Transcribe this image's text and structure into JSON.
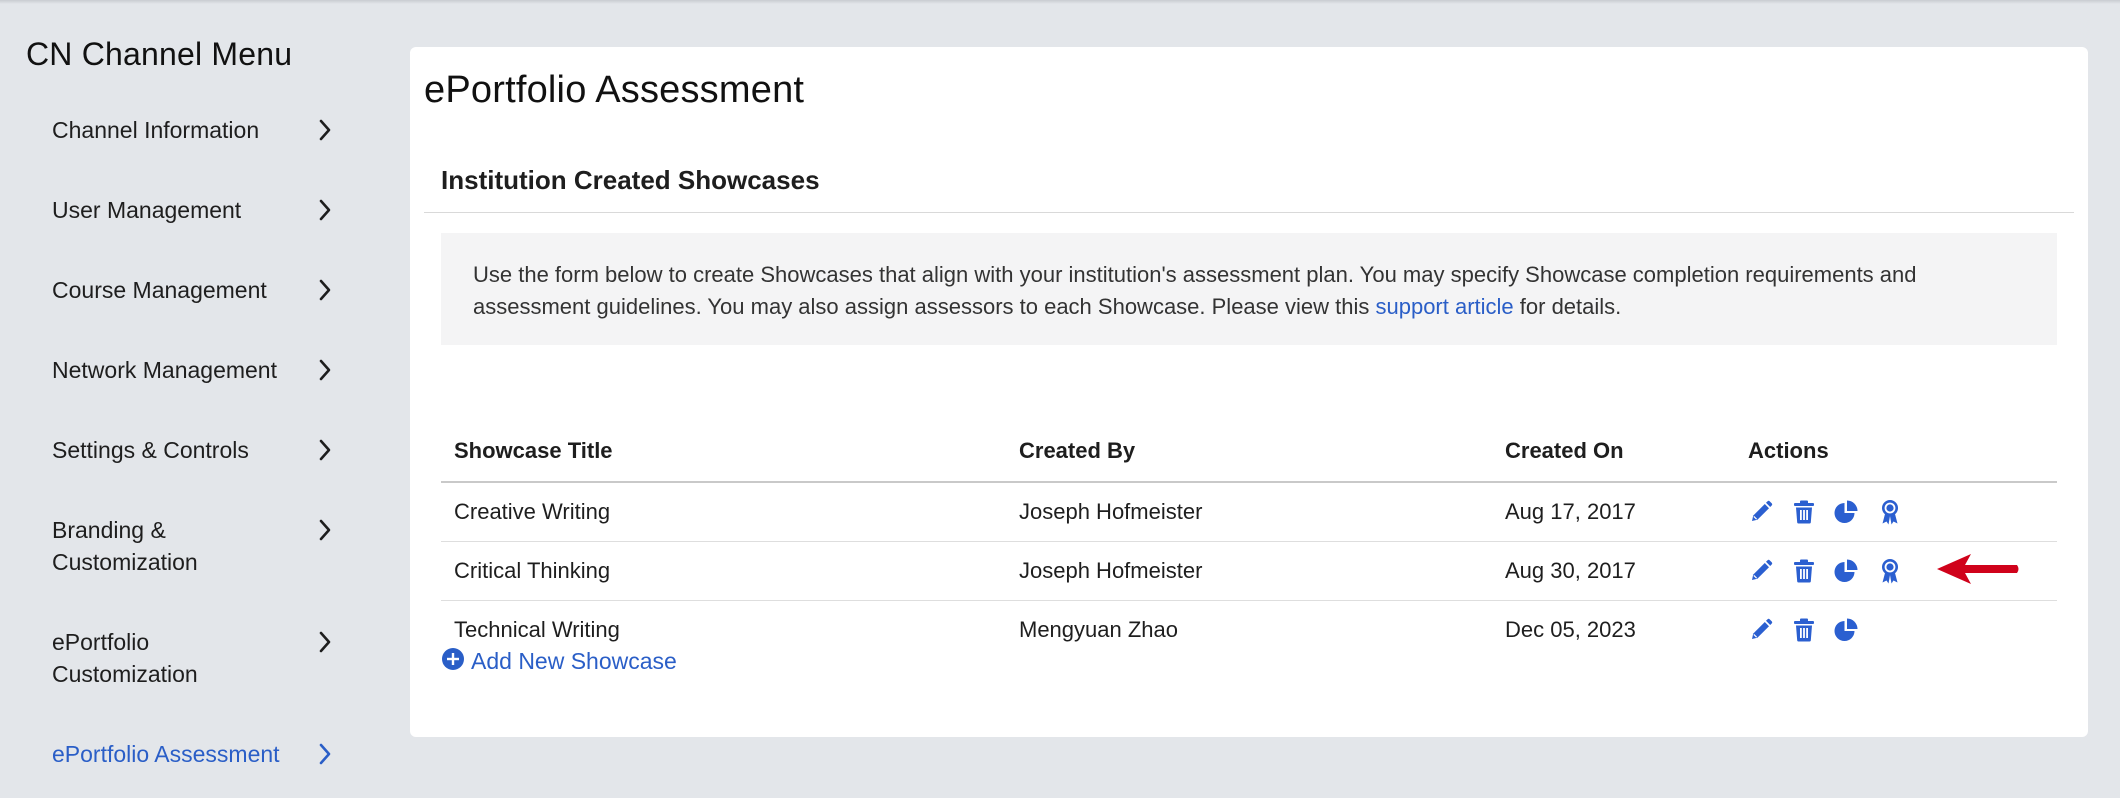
{
  "sidebar": {
    "title": "CN Channel Menu",
    "items": [
      {
        "label": "Channel Information"
      },
      {
        "label": "User Management"
      },
      {
        "label": "Course Management"
      },
      {
        "label": "Network Management"
      },
      {
        "label": "Settings & Controls"
      },
      {
        "label": "Branding & Customization"
      },
      {
        "label": "ePortfolio Customization"
      },
      {
        "label": "ePortfolio Assessment",
        "active": true
      }
    ]
  },
  "main": {
    "title": "ePortfolio Assessment",
    "section_title": "Institution Created Showcases",
    "info": {
      "text_before": "Use the form below to create Showcases that align with your institution's assessment plan. You may specify Showcase completion requirements and assessment guidelines. You may also assign assessors to each Showcase. Please view this ",
      "link_text": "support article",
      "text_after": " for details."
    },
    "table": {
      "headers": {
        "title": "Showcase Title",
        "created_by": "Created By",
        "created_on": "Created On",
        "actions": "Actions"
      },
      "rows": [
        {
          "title": "Creative Writing",
          "created_by": "Joseph Hofmeister",
          "created_on": "Aug 17, 2017",
          "actions": [
            "pencil-icon",
            "trash-icon",
            "pie-chart-icon",
            "award-ribbon-icon"
          ]
        },
        {
          "title": "Critical Thinking",
          "created_by": "Joseph Hofmeister",
          "created_on": "Aug 30, 2017",
          "actions": [
            "pencil-icon",
            "trash-icon",
            "pie-chart-icon",
            "award-ribbon-icon"
          ]
        },
        {
          "title": "Technical Writing",
          "created_by": "Mengyuan Zhao",
          "created_on": "Dec 05, 2023",
          "actions": [
            "pencil-icon",
            "trash-icon",
            "pie-chart-icon"
          ]
        }
      ]
    },
    "add_button": {
      "label": "Add New Showcase",
      "icon": "plus-circle-icon"
    }
  },
  "colors": {
    "accent": "#2a5ec7",
    "icon": "#2b5fd0",
    "annotation_arrow": "#d0021b",
    "background": "#e3e6ea",
    "card": "#ffffff",
    "info_box": "#f4f4f5"
  }
}
